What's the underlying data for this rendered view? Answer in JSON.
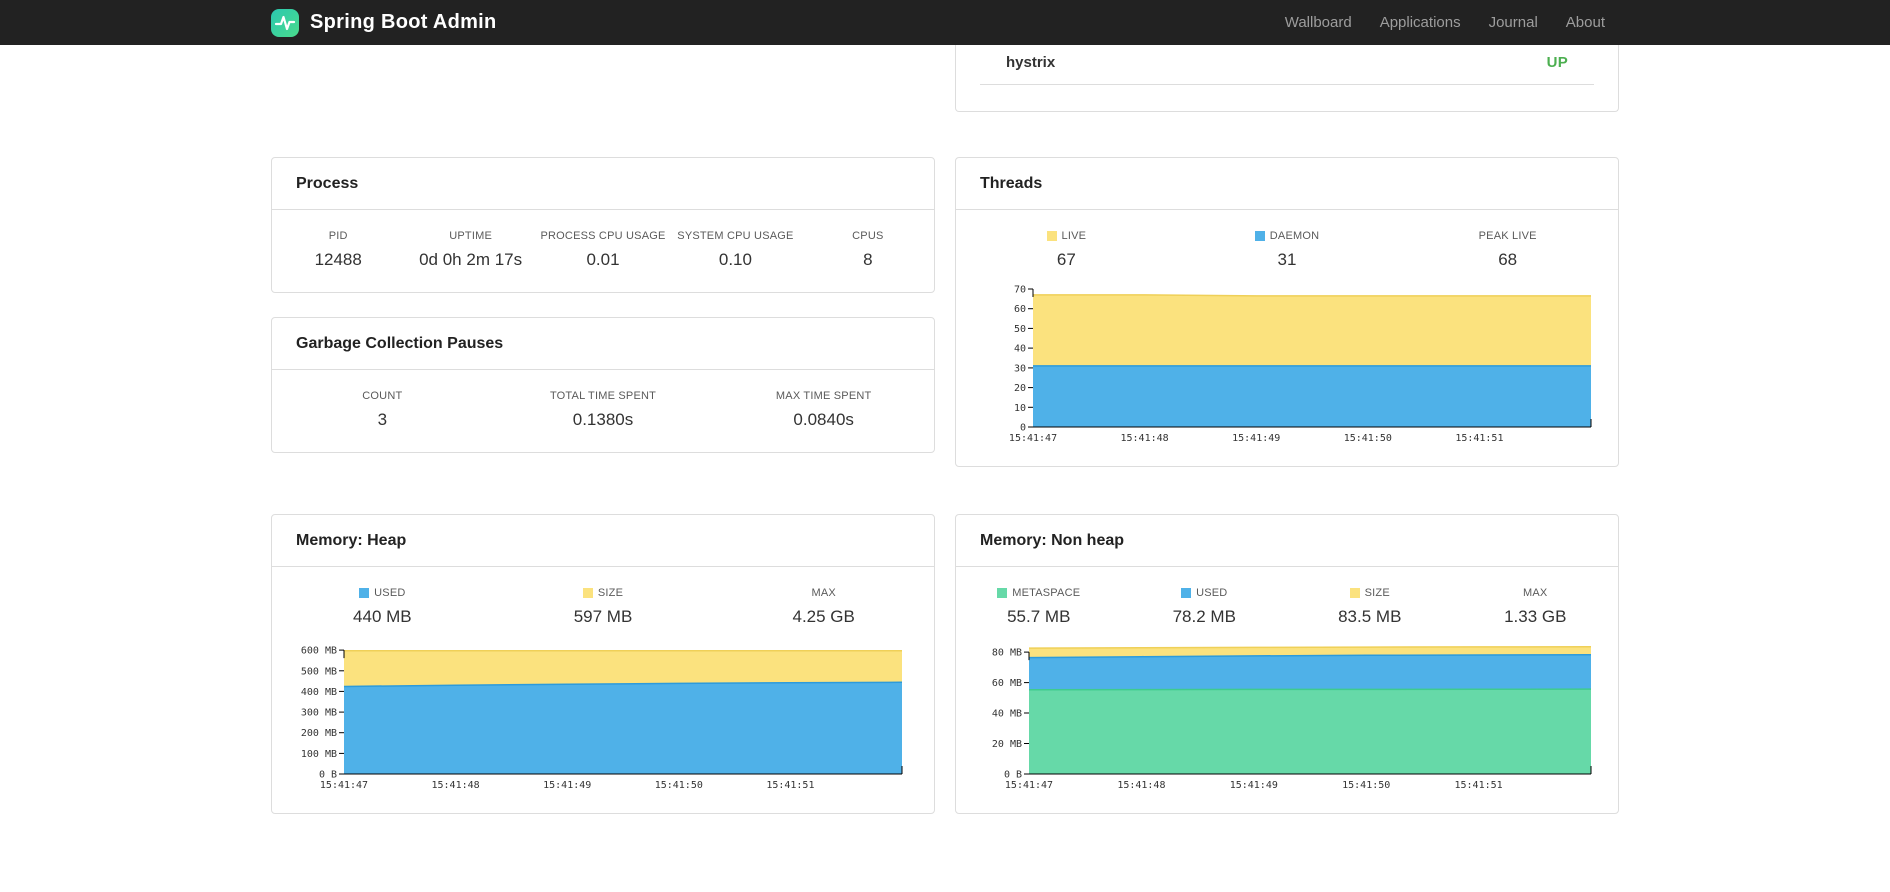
{
  "colors": {
    "yellow": "#FBE27E",
    "yellow_stroke": "#EFD058",
    "blue": "#4FB1E8",
    "blue_stroke": "#2D9BDB",
    "green": "#66D9A8",
    "green_stroke": "#3FCB8E",
    "status_up": "#4CAF50",
    "brand_green": "#36D7A0",
    "navbar_bg": "#222222"
  },
  "navbar": {
    "brand": "Spring Boot Admin",
    "items": [
      {
        "label": "Wallboard"
      },
      {
        "label": "Applications"
      },
      {
        "label": "Journal"
      },
      {
        "label": "About"
      }
    ]
  },
  "health": {
    "rows": [
      {
        "name": "hystrix",
        "status": "UP"
      }
    ]
  },
  "process": {
    "title": "Process",
    "metrics": [
      {
        "label": "PID",
        "value": "12488"
      },
      {
        "label": "UPTIME",
        "value": "0d 0h 2m 17s"
      },
      {
        "label": "PROCESS CPU USAGE",
        "value": "0.01"
      },
      {
        "label": "SYSTEM CPU USAGE",
        "value": "0.10"
      },
      {
        "label": "CPUS",
        "value": "8"
      }
    ]
  },
  "gc": {
    "title": "Garbage Collection Pauses",
    "metrics": [
      {
        "label": "COUNT",
        "value": "3"
      },
      {
        "label": "TOTAL TIME SPENT",
        "value": "0.1380s"
      },
      {
        "label": "MAX TIME SPENT",
        "value": "0.0840s"
      }
    ]
  },
  "threads": {
    "title": "Threads",
    "legend": [
      {
        "label": "LIVE",
        "value": "67",
        "swatch": "yellow"
      },
      {
        "label": "DAEMON",
        "value": "31",
        "swatch": "blue"
      },
      {
        "label": "PEAK LIVE",
        "value": "68",
        "swatch": ""
      }
    ]
  },
  "memory_heap": {
    "title": "Memory: Heap",
    "legend": [
      {
        "label": "USED",
        "value": "440 MB",
        "swatch": "blue"
      },
      {
        "label": "SIZE",
        "value": "597 MB",
        "swatch": "yellow"
      },
      {
        "label": "MAX",
        "value": "4.25 GB",
        "swatch": ""
      }
    ]
  },
  "memory_nonheap": {
    "title": "Memory: Non heap",
    "legend": [
      {
        "label": "METASPACE",
        "value": "55.7 MB",
        "swatch": "green"
      },
      {
        "label": "USED",
        "value": "78.2 MB",
        "swatch": "blue"
      },
      {
        "label": "SIZE",
        "value": "83.5 MB",
        "swatch": "yellow"
      },
      {
        "label": "MAX",
        "value": "1.33 GB",
        "swatch": ""
      }
    ]
  },
  "chart_data": [
    {
      "mount": "chart-threads",
      "type": "area",
      "title": "Threads",
      "x_labels": [
        "15:41:47",
        "15:41:48",
        "15:41:49",
        "15:41:50",
        "15:41:51"
      ],
      "ylim": [
        0,
        70
      ],
      "yticks": [
        {
          "v": 70,
          "label": "70"
        },
        {
          "v": 60,
          "label": "60"
        },
        {
          "v": 50,
          "label": "50"
        },
        {
          "v": 40,
          "label": "40"
        },
        {
          "v": 30,
          "label": "30"
        },
        {
          "v": 20,
          "label": "20"
        },
        {
          "v": 10,
          "label": "10"
        },
        {
          "v": 0,
          "label": "0"
        }
      ],
      "series": [
        {
          "name": "LIVE",
          "fill": "#FBE27E",
          "stroke": "#EFD058",
          "values": [
            67,
            67,
            66.5,
            66.5,
            66.5,
            66.5
          ]
        },
        {
          "name": "DAEMON",
          "fill": "#4FB1E8",
          "stroke": "#2D9BDB",
          "values": [
            31,
            31,
            31,
            31,
            31,
            31
          ]
        }
      ]
    },
    {
      "mount": "chart-heap",
      "type": "area",
      "title": "Memory: Heap",
      "x_labels": [
        "15:41:47",
        "15:41:48",
        "15:41:49",
        "15:41:50",
        "15:41:51"
      ],
      "ylim": [
        0,
        620
      ],
      "yticks": [
        {
          "v": 600,
          "label": "600 MB"
        },
        {
          "v": 500,
          "label": "500 MB"
        },
        {
          "v": 400,
          "label": "400 MB"
        },
        {
          "v": 300,
          "label": "300 MB"
        },
        {
          "v": 200,
          "label": "200 MB"
        },
        {
          "v": 100,
          "label": "100 MB"
        },
        {
          "v": 0,
          "label": "0 B"
        }
      ],
      "series": [
        {
          "name": "SIZE",
          "fill": "#FBE27E",
          "stroke": "#EFD058",
          "values": [
            597,
            597,
            597,
            597,
            597,
            597
          ]
        },
        {
          "name": "USED",
          "fill": "#4FB1E8",
          "stroke": "#2D9BDB",
          "values": [
            424,
            430,
            435,
            439,
            442,
            444
          ]
        }
      ]
    },
    {
      "mount": "chart-nonheap",
      "type": "area",
      "title": "Memory: Non heap",
      "x_labels": [
        "15:41:47",
        "15:41:48",
        "15:41:49",
        "15:41:50",
        "15:41:51"
      ],
      "ylim": [
        0,
        84
      ],
      "yticks": [
        {
          "v": 80,
          "label": "80 MB"
        },
        {
          "v": 60,
          "label": "60 MB"
        },
        {
          "v": 40,
          "label": "40 MB"
        },
        {
          "v": 20,
          "label": "20 MB"
        },
        {
          "v": 0,
          "label": "0 B"
        }
      ],
      "series": [
        {
          "name": "SIZE",
          "fill": "#FBE27E",
          "stroke": "#EFD058",
          "values": [
            82.6,
            82.9,
            83.1,
            83.3,
            83.4,
            83.5
          ]
        },
        {
          "name": "USED",
          "fill": "#4FB1E8",
          "stroke": "#2D9BDB",
          "values": [
            76.4,
            77.0,
            77.5,
            77.9,
            78.1,
            78.2
          ]
        },
        {
          "name": "METASPACE",
          "fill": "#66D9A8",
          "stroke": "#3FCB8E",
          "values": [
            55.3,
            55.4,
            55.5,
            55.5,
            55.6,
            55.7
          ]
        }
      ]
    }
  ]
}
